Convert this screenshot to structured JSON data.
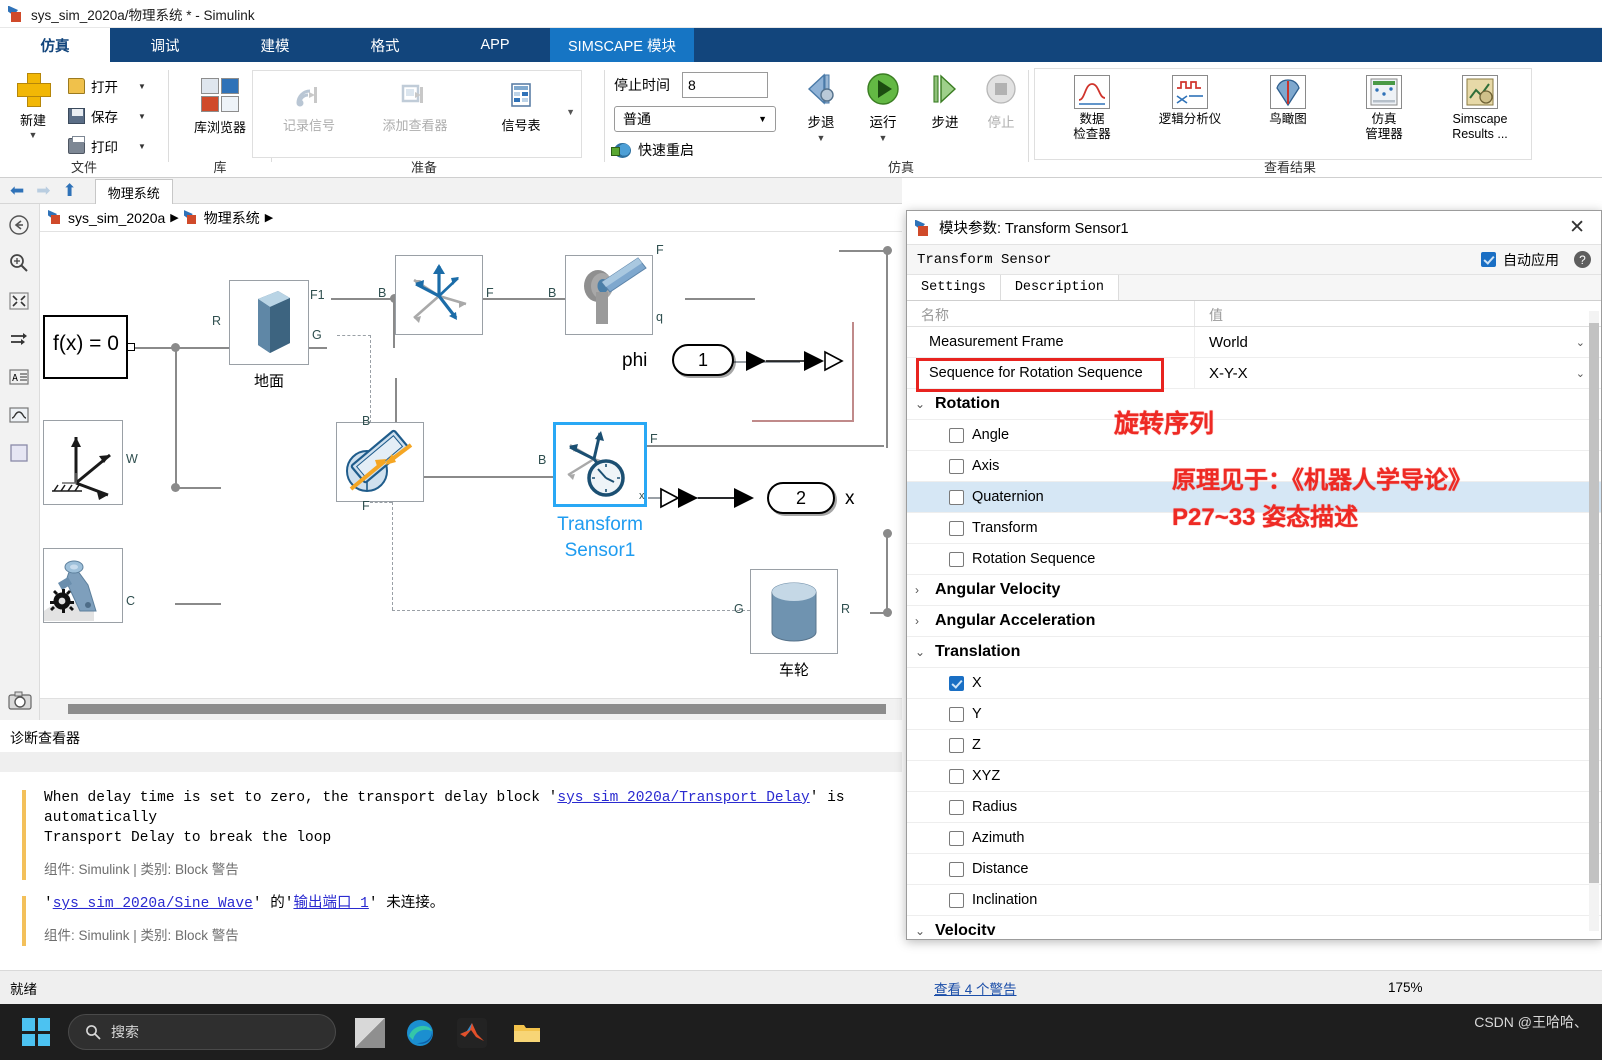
{
  "window": {
    "title": "sys_sim_2020a/物理系统 * - Simulink",
    "icon": "simulink-model-icon"
  },
  "ribbon": {
    "tabs": [
      {
        "label": "仿真",
        "active": true
      },
      {
        "label": "调试",
        "active": false
      },
      {
        "label": "建模",
        "active": false
      },
      {
        "label": "格式",
        "active": false
      },
      {
        "label": "APP",
        "active": false
      },
      {
        "label": "SIMSCAPE 模块",
        "active": false,
        "highlight": true
      }
    ],
    "groups": {
      "file": {
        "label": "文件",
        "new_label": "新建",
        "items": [
          {
            "label": "打开",
            "icon": "folder-open-icon"
          },
          {
            "label": "保存",
            "icon": "save-disk-icon"
          },
          {
            "label": "打印",
            "icon": "printer-icon"
          }
        ]
      },
      "library": {
        "label": "库",
        "browser_label": "库浏览器",
        "icon": "library-browser-icon"
      },
      "prepare": {
        "label": "准备",
        "items": [
          {
            "label": "记录信号",
            "icon": "log-signals-icon",
            "enabled": false
          },
          {
            "label": "添加查看器",
            "icon": "add-viewer-icon",
            "enabled": false
          },
          {
            "label": "信号表",
            "icon": "signal-table-icon",
            "enabled": true
          }
        ]
      },
      "simulate": {
        "label": "仿真",
        "stop_time_label": "停止时间",
        "stop_time_value": "8",
        "mode_value": "普通",
        "fast_restart_label": "快速重启",
        "buttons": [
          {
            "label": "步退",
            "icon": "step-back-icon",
            "enabled": true,
            "dropdown": true
          },
          {
            "label": "运行",
            "icon": "run-play-icon",
            "enabled": true,
            "dropdown": true
          },
          {
            "label": "步进",
            "icon": "step-forward-icon",
            "enabled": true,
            "dropdown": false
          },
          {
            "label": "停止",
            "icon": "stop-icon",
            "enabled": false,
            "dropdown": false
          }
        ]
      },
      "results": {
        "label": "查看结果",
        "items": [
          {
            "label": "数据\n检查器",
            "line1": "数据",
            "line2": "检查器",
            "icon": "data-inspector-icon"
          },
          {
            "label": "逻辑分析仪",
            "line1": "逻辑分析仪",
            "line2": "",
            "icon": "logic-analyzer-icon"
          },
          {
            "label": "鸟瞰图",
            "line1": "鸟瞰图",
            "line2": "",
            "icon": "birds-eye-scope-icon"
          },
          {
            "label": "仿真\n管理器",
            "line1": "仿真",
            "line2": "管理器",
            "icon": "simulation-manager-icon"
          },
          {
            "label": "Simscape\nResults ...",
            "line1": "Simscape",
            "line2": "Results ...",
            "icon": "simscape-results-icon"
          }
        ]
      }
    }
  },
  "canvas": {
    "tab_label": "物理系统",
    "breadcrumb": [
      {
        "label": "sys_sim_2020a"
      },
      {
        "label": "物理系统"
      }
    ],
    "blocks": [
      {
        "name": "solver-config",
        "label": "f(x) = 0",
        "caption": ""
      },
      {
        "name": "ground-block",
        "caption": "地面",
        "ports": [
          "R",
          "F1",
          "G"
        ]
      },
      {
        "name": "world-frame-block",
        "caption": "",
        "ports": [
          "W"
        ]
      },
      {
        "name": "mechanism-config-block",
        "caption": "",
        "ports": [
          "C"
        ]
      },
      {
        "name": "rigid-transform-block",
        "caption": "",
        "ports": [
          "B",
          "F"
        ]
      },
      {
        "name": "revolute-joint-block",
        "caption": "",
        "ports": [
          "B",
          "F",
          "q"
        ]
      },
      {
        "name": "prismatic-block",
        "caption": "",
        "ports": [
          "B",
          "F"
        ]
      },
      {
        "name": "transform-sensor1-block",
        "caption": "Transform\nSensor1",
        "caption_line1": "Transform",
        "caption_line2": "Sensor1",
        "ports": [
          "B",
          "F",
          "x"
        ]
      },
      {
        "name": "wheel-block",
        "caption": "车轮",
        "ports": [
          "G",
          "R"
        ]
      }
    ],
    "outports": [
      {
        "name": "outport-phi",
        "number": "1",
        "label": "phi"
      },
      {
        "name": "outport-x",
        "number": "2",
        "label": "x"
      }
    ]
  },
  "diagnostics": {
    "panel_title": "诊断查看器",
    "messages": [
      {
        "text_before": "When delay time is set to zero, the transport delay block '",
        "link": "sys_sim_2020a/Transport Delay",
        "text_after": "' is automatically\nTransport Delay to break the loop",
        "meta": "组件: Simulink | 类别: Block 警告"
      },
      {
        "text_before": "'",
        "link": "sys_sim_2020a/Sine Wave",
        "mid": "' 的'",
        "link2": "输出端口 1",
        "text_after": "' 未连接。",
        "meta": "组件: Simulink | 类别: Block 警告"
      }
    ]
  },
  "status_bar": {
    "ready": "就绪",
    "warnings": "查看 4 个警告",
    "zoom": "175%"
  },
  "taskbar": {
    "search_placeholder": "搜索",
    "icons": [
      "start-icon",
      "search-icon",
      "task-view-icon",
      "edge-icon",
      "matlab-icon",
      "file-explorer-icon"
    ],
    "watermark": "CSDN @王哈哈、"
  },
  "dialog": {
    "title": "模块参数: Transform Sensor1",
    "block_name": "Transform Sensor",
    "auto_apply_label": "自动应用",
    "auto_apply_checked": true,
    "help_icon": "help-question-icon",
    "close_icon": "close-icon",
    "tabs": [
      {
        "label": "Settings",
        "active": true
      },
      {
        "label": "Description",
        "active": false
      }
    ],
    "columns": {
      "name": "名称",
      "value": "值"
    },
    "parameters": [
      {
        "name": "Measurement Frame",
        "value": "World",
        "highlighted": false
      },
      {
        "name": "Sequence for Rotation Sequence",
        "value": "X-Y-X",
        "highlighted": true
      }
    ],
    "sections": [
      {
        "name": "Rotation",
        "expanded": true,
        "items": [
          {
            "label": "Angle",
            "checked": false,
            "highlighted": false
          },
          {
            "label": "Axis",
            "checked": false,
            "highlighted": false
          },
          {
            "label": "Quaternion",
            "checked": false,
            "highlighted": true
          },
          {
            "label": "Transform",
            "checked": false,
            "highlighted": false
          },
          {
            "label": "Rotation Sequence",
            "checked": false,
            "highlighted": false
          }
        ]
      },
      {
        "name": "Angular Velocity",
        "expanded": false,
        "items": []
      },
      {
        "name": "Angular Acceleration",
        "expanded": false,
        "items": []
      },
      {
        "name": "Translation",
        "expanded": true,
        "items": [
          {
            "label": "X",
            "checked": true,
            "highlighted": false
          },
          {
            "label": "Y",
            "checked": false,
            "highlighted": false
          },
          {
            "label": "Z",
            "checked": false,
            "highlighted": false
          },
          {
            "label": "XYZ",
            "checked": false,
            "highlighted": false
          },
          {
            "label": "Radius",
            "checked": false,
            "highlighted": false
          },
          {
            "label": "Azimuth",
            "checked": false,
            "highlighted": false
          },
          {
            "label": "Distance",
            "checked": false,
            "highlighted": false
          },
          {
            "label": "Inclination",
            "checked": false,
            "highlighted": false
          }
        ]
      },
      {
        "name": "Velocity",
        "expanded": true,
        "items": []
      }
    ]
  },
  "annotations": [
    {
      "name": "annotation-rotation-sequence",
      "text": "旋转序列",
      "color": "#ee2a24"
    },
    {
      "name": "annotation-reference-book",
      "text": "原理见于：《机器人学导论》",
      "color": "#ee2a24"
    },
    {
      "name": "annotation-reference-pages",
      "text": "P27~33 姿态描述",
      "color": "#ee2a24"
    }
  ],
  "colors": {
    "ribbon_blue": "#12457c",
    "simscape_tab_blue": "#1675c4",
    "accent_red": "#ee2a24",
    "selection_blue": "#29a8f5",
    "link_blue": "#2a2ad0"
  }
}
